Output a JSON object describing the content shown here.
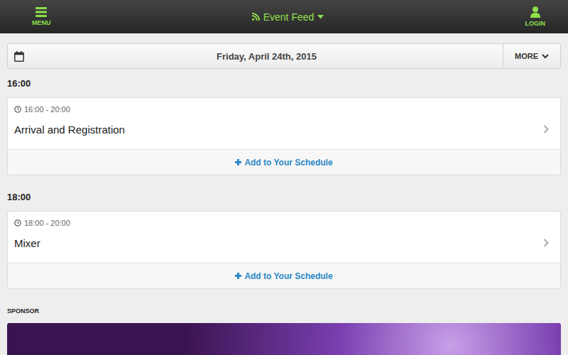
{
  "top_bar": {
    "menu": "MENU",
    "feed": "Event Feed",
    "login": "LOGIN"
  },
  "date_bar": {
    "date": "Friday, April 24th, 2015",
    "more": "MORE"
  },
  "time_groups": [
    {
      "time": "16:00",
      "events": [
        {
          "time_range": "16:00 - 20:00",
          "title": "Arrival and Registration",
          "action": "Add to Your Schedule"
        }
      ]
    },
    {
      "time": "18:00",
      "events": [
        {
          "time_range": "18:00 - 20:00",
          "title": "Mixer",
          "action": "Add to Your Schedule"
        }
      ]
    }
  ],
  "sponsor": {
    "label": "SPONSOR"
  }
}
